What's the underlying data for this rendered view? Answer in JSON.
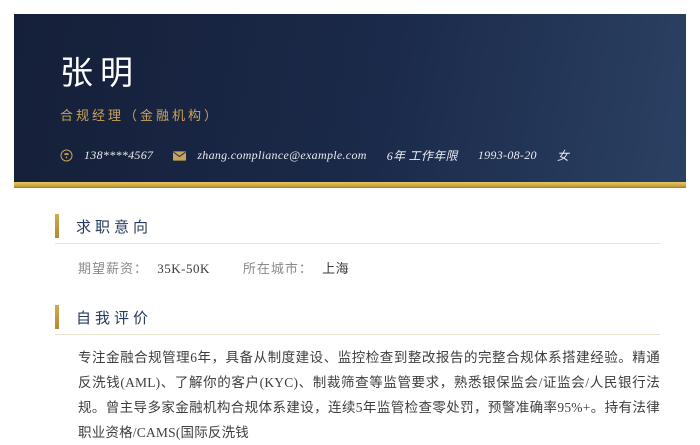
{
  "colors": {
    "header_navy_left": "#151F38",
    "header_navy_right": "#2B4163",
    "accent_gold": "#C9A35B",
    "heading_navy": "#26395C"
  },
  "header": {
    "name": "张明",
    "job_title": "合规经理（金融机构）",
    "contact": {
      "phone": "138****4567",
      "email": "zhang.compliance@example.com",
      "work_years": "6年 工作年限",
      "birth_date": "1993-08-20",
      "gender": "女"
    },
    "icons": {
      "phone": "phone-icon",
      "email": "envelope-icon"
    }
  },
  "sections": {
    "job_intent": {
      "heading": "求职意向",
      "fields": [
        {
          "label": "期望薪资：",
          "value": "35K-50K"
        },
        {
          "label": "所在城市：",
          "value": "上海"
        }
      ]
    },
    "self_evaluation": {
      "heading": "自我评价",
      "text": "专注金融合规管理6年，具备从制度建设、监控检查到整改报告的完整合规体系搭建经验。精通反洗钱(AML)、了解你的客户(KYC)、制裁筛查等监管要求，熟悉银保监会/证监会/人民银行法规。曾主导多家金融机构合规体系建设，连续5年监管检查零处罚，预警准确率95%+。持有法律职业资格/CAMS(国际反洗钱"
    }
  }
}
